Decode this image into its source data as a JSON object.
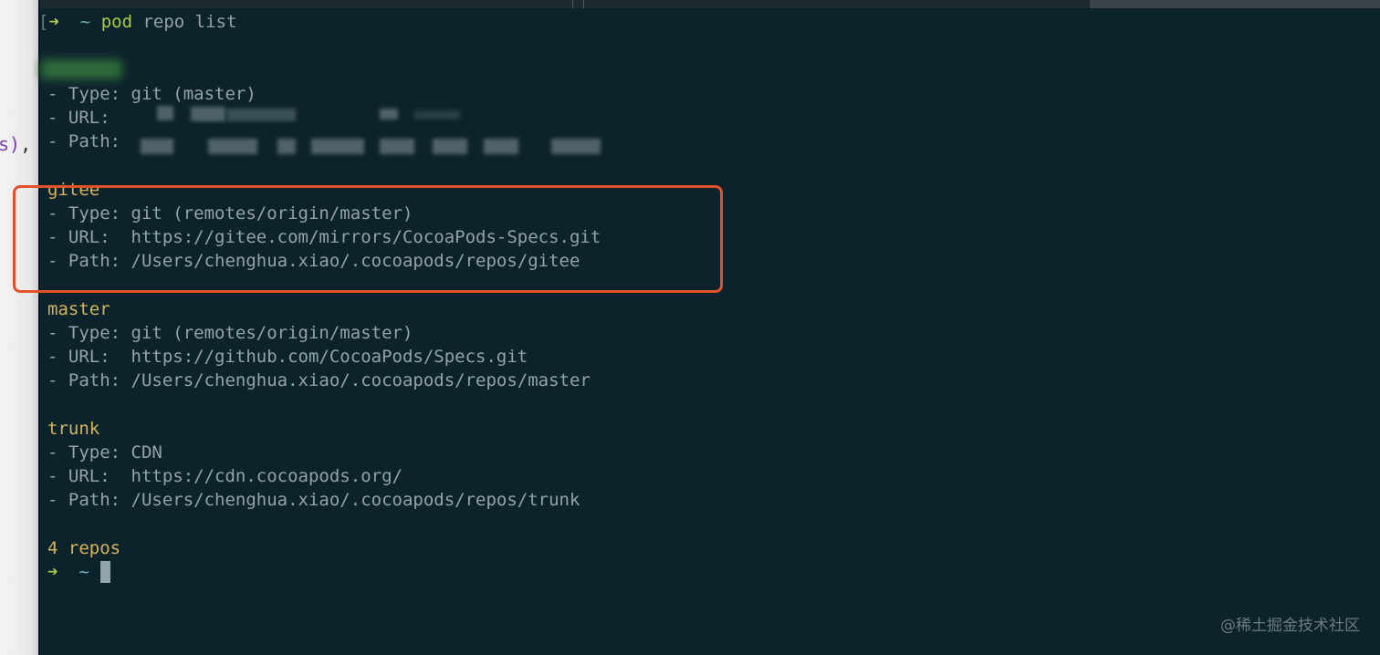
{
  "editor_fragment": {
    "text": "s)",
    "comma": ","
  },
  "prompt": {
    "bracket": "[",
    "arrow": "➜",
    "tilde": "~",
    "command": "pod",
    "args": "repo list"
  },
  "repos": [
    {
      "name": "",
      "type_label": "- Type:",
      "type_value": "git (master)",
      "url_label": "- URL:",
      "url_value": "",
      "path_label": "- Path:",
      "path_value": ""
    },
    {
      "name": "gitee",
      "type_label": "- Type:",
      "type_value": "git (remotes/origin/master)",
      "url_label": "- URL:",
      "url_value": "https://gitee.com/mirrors/CocoaPods-Specs.git",
      "path_label": "- Path:",
      "path_value": "/Users/chenghua.xiao/.cocoapods/repos/gitee"
    },
    {
      "name": "master",
      "type_label": "- Type:",
      "type_value": "git (remotes/origin/master)",
      "url_label": "- URL:",
      "url_value": "https://github.com/CocoaPods/Specs.git",
      "path_label": "- Path:",
      "path_value": "/Users/chenghua.xiao/.cocoapods/repos/master"
    },
    {
      "name": "trunk",
      "type_label": "- Type:",
      "type_value": "CDN",
      "url_label": "- URL:",
      "url_value": "https://cdn.cocoapods.org/",
      "path_label": "- Path:",
      "path_value": "/Users/chenghua.xiao/.cocoapods/repos/trunk"
    }
  ],
  "summary": "4 repos",
  "final_prompt": {
    "arrow": "➜",
    "tilde": "~"
  },
  "watermark": "@稀土掘金技术社区",
  "colors": {
    "background": "#0d232c",
    "repo_name": "#d6b45c",
    "highlight_border": "#e2512a",
    "prompt_arrow": "#a8c94a",
    "text": "#93a3a8"
  }
}
